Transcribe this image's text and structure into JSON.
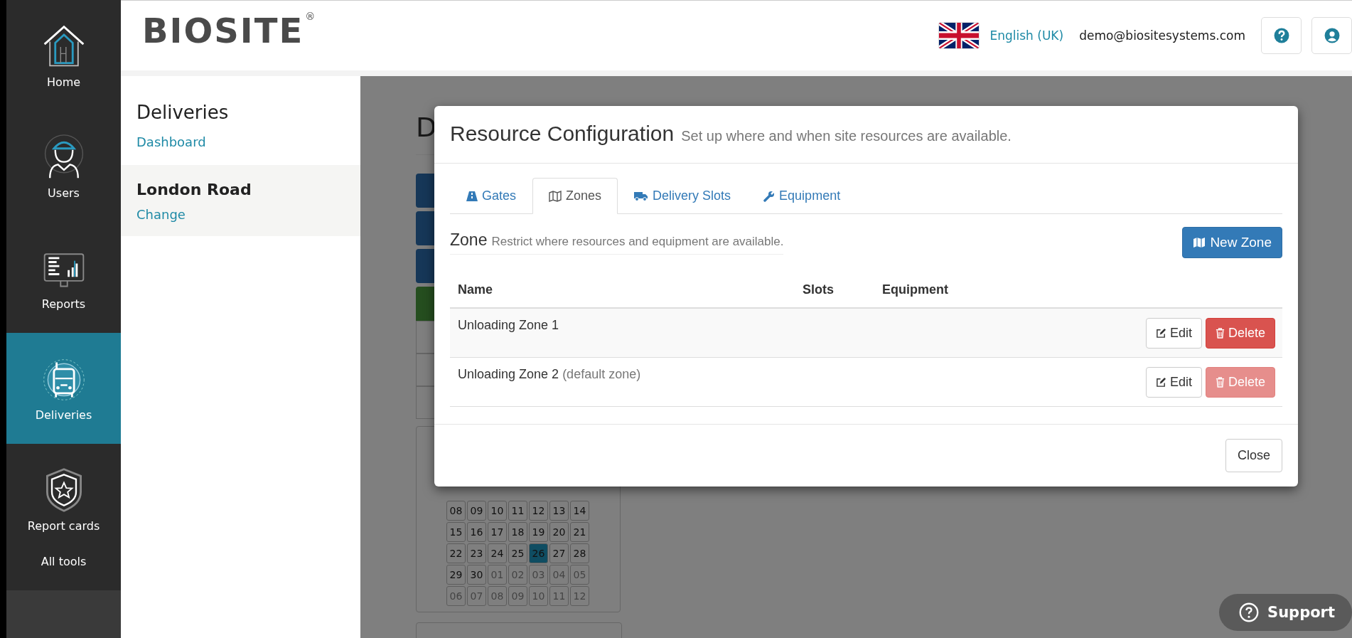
{
  "nav": [
    {
      "label": "Home",
      "selected": false
    },
    {
      "label": "Users",
      "selected": false
    },
    {
      "label": "Reports",
      "selected": false
    },
    {
      "label": "Deliveries",
      "selected": true
    },
    {
      "label": "Report cards",
      "selected": false
    },
    {
      "label": "All tools",
      "selected": false
    }
  ],
  "header": {
    "brand": "BIOSITE",
    "brand_mark": "®",
    "language": "English (UK)",
    "email": "demo@biositesystems.com"
  },
  "sidebar": {
    "title": "Deliveries",
    "link": "Dashboard",
    "site": "London Road",
    "change": "Change"
  },
  "main": {
    "heading": "D",
    "calendar": [
      [
        {
          "day": "08",
          "muted": false,
          "selected": false
        },
        {
          "day": "09",
          "muted": false,
          "selected": false
        },
        {
          "day": "10",
          "muted": false,
          "selected": false
        },
        {
          "day": "11",
          "muted": false,
          "selected": false
        },
        {
          "day": "12",
          "muted": false,
          "selected": false
        },
        {
          "day": "13",
          "muted": false,
          "selected": false
        },
        {
          "day": "14",
          "muted": false,
          "selected": false
        }
      ],
      [
        {
          "day": "15",
          "muted": false,
          "selected": false
        },
        {
          "day": "16",
          "muted": false,
          "selected": false
        },
        {
          "day": "17",
          "muted": false,
          "selected": false
        },
        {
          "day": "18",
          "muted": false,
          "selected": false
        },
        {
          "day": "19",
          "muted": false,
          "selected": false
        },
        {
          "day": "20",
          "muted": false,
          "selected": false
        },
        {
          "day": "21",
          "muted": false,
          "selected": false
        }
      ],
      [
        {
          "day": "22",
          "muted": false,
          "selected": false
        },
        {
          "day": "23",
          "muted": false,
          "selected": false
        },
        {
          "day": "24",
          "muted": false,
          "selected": false
        },
        {
          "day": "25",
          "muted": false,
          "selected": false
        },
        {
          "day": "26",
          "muted": false,
          "selected": true
        },
        {
          "day": "27",
          "muted": false,
          "selected": false
        },
        {
          "day": "28",
          "muted": false,
          "selected": false
        }
      ],
      [
        {
          "day": "29",
          "muted": false,
          "selected": false
        },
        {
          "day": "30",
          "muted": false,
          "selected": false
        },
        {
          "day": "01",
          "muted": true,
          "selected": false
        },
        {
          "day": "02",
          "muted": true,
          "selected": false
        },
        {
          "day": "03",
          "muted": true,
          "selected": false
        },
        {
          "day": "04",
          "muted": true,
          "selected": false
        },
        {
          "day": "05",
          "muted": true,
          "selected": false
        }
      ],
      [
        {
          "day": "06",
          "muted": true,
          "selected": false
        },
        {
          "day": "07",
          "muted": true,
          "selected": false
        },
        {
          "day": "08",
          "muted": true,
          "selected": false
        },
        {
          "day": "09",
          "muted": true,
          "selected": false
        },
        {
          "day": "10",
          "muted": true,
          "selected": false
        },
        {
          "day": "11",
          "muted": true,
          "selected": false
        },
        {
          "day": "12",
          "muted": true,
          "selected": false
        }
      ]
    ]
  },
  "modal": {
    "title": "Resource Configuration",
    "subtitle": "Set up where and when site resources are available.",
    "tabs": [
      {
        "label": "Gates",
        "selected": false
      },
      {
        "label": "Zones",
        "selected": true
      },
      {
        "label": "Delivery Slots",
        "selected": false
      },
      {
        "label": "Equipment",
        "selected": false
      }
    ],
    "section_title": "Zone",
    "section_subtitle": "Restrict where resources and equipment are available.",
    "new_button": "New Zone",
    "columns": [
      "Name",
      "Slots",
      "Equipment"
    ],
    "rows": [
      {
        "name": "Unloading Zone 1",
        "edit": "Edit",
        "delete": "Delete",
        "delete_disabled": false
      },
      {
        "name": "Unloading Zone 2",
        "note": "(default zone)",
        "edit": "Edit",
        "delete": "Delete",
        "delete_disabled": true
      }
    ],
    "close": "Close"
  },
  "support": "Support"
}
